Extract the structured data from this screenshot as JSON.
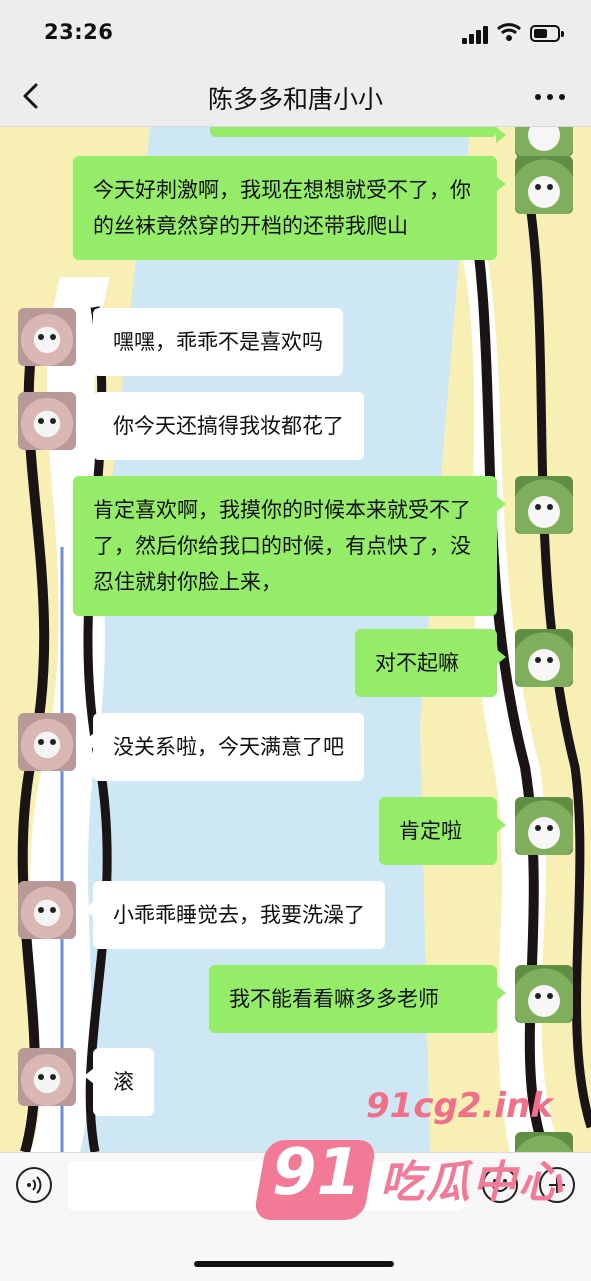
{
  "status_bar": {
    "time": "23:26"
  },
  "nav": {
    "title": "陈多多和唐小小"
  },
  "messages": [
    {
      "side": "right",
      "text": "今天好刺激啊，我现在想想就受不了，你的丝袜竟然穿的开档的还带我爬山"
    },
    {
      "side": "left",
      "text": "嘿嘿，乖乖不是喜欢吗"
    },
    {
      "side": "left",
      "text": "你今天还搞得我妆都花了"
    },
    {
      "side": "right",
      "text": "肯定喜欢啊，我摸你的时候本来就受不了了，然后你给我口的时候，有点快了，没忍住就射你脸上来，"
    },
    {
      "side": "right",
      "text": "对不起嘛"
    },
    {
      "side": "left",
      "text": "没关系啦，今天满意了吧"
    },
    {
      "side": "right",
      "text": "肯定啦"
    },
    {
      "side": "left",
      "text": "小乖乖睡觉去，我要洗澡了"
    },
    {
      "side": "right",
      "text": "我不能看看嘛多多老师"
    },
    {
      "side": "left",
      "text": "滚"
    }
  ],
  "watermark": {
    "url": "91cg2.ink",
    "logo": "91",
    "name": "吃瓜中心"
  },
  "colors": {
    "bubble_right": "#95ec69",
    "bubble_left": "#ffffff",
    "watermark": "#f27a96"
  },
  "icons": [
    "back-icon",
    "more-icon",
    "voice-icon",
    "emoji-icon",
    "plus-icon"
  ]
}
